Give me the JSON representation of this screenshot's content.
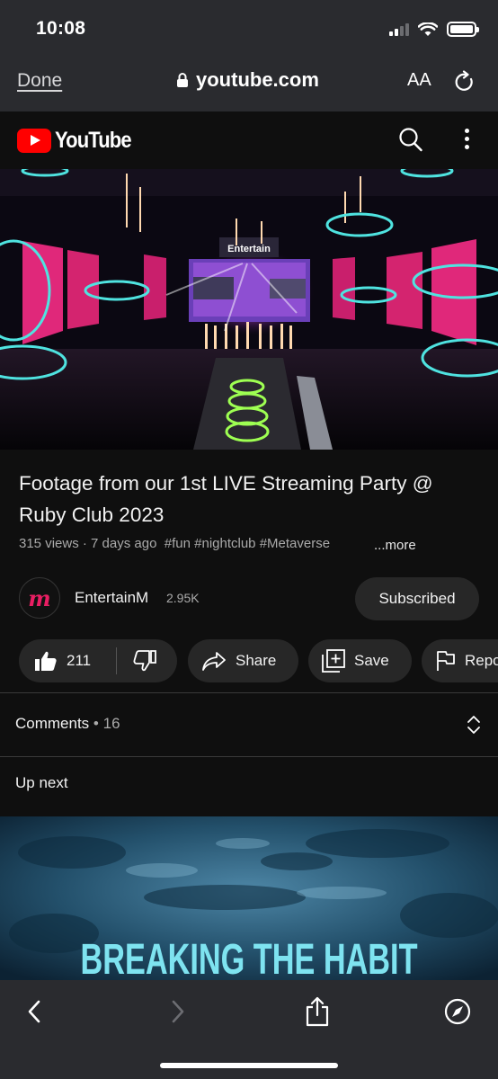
{
  "status_bar": {
    "time": "10:08"
  },
  "browser": {
    "done_label": "Done",
    "url": "youtube.com",
    "text_size_label": "AA"
  },
  "youtube": {
    "wordmark": "YouTube"
  },
  "video": {
    "title": "Footage from our 1st LIVE Streaming Party @ Ruby Club 2023",
    "views": "315 views",
    "age": "7 days ago",
    "hashtags": "#fun #nightclub #Metaverse",
    "more_label": "...more",
    "stage_sign": "Entertain"
  },
  "channel": {
    "avatar_letter": "m",
    "name": "EntertainM",
    "subscribers": "2.95K",
    "subscribe_state": "Subscribed"
  },
  "actions": {
    "likes": "211",
    "share_label": "Share",
    "save_label": "Save",
    "report_label": "Report"
  },
  "comments": {
    "label": "Comments",
    "count": "16"
  },
  "up_next": {
    "label": "Up next",
    "thumbnail_title": "BREAKING THE HABIT"
  },
  "colors": {
    "youtube_red": "#ff0000",
    "background": "#0f0f0f",
    "pill": "#272727",
    "browser_chrome": "#2a2b2f"
  },
  "icons": [
    "lock-icon",
    "reload-icon",
    "search-icon",
    "more-vert-icon",
    "thumbs-up-icon",
    "thumbs-down-icon",
    "share-icon",
    "save-playlist-icon",
    "flag-icon",
    "expand-chevrons-icon",
    "back-icon",
    "forward-icon",
    "share-sheet-icon",
    "compass-icon"
  ]
}
